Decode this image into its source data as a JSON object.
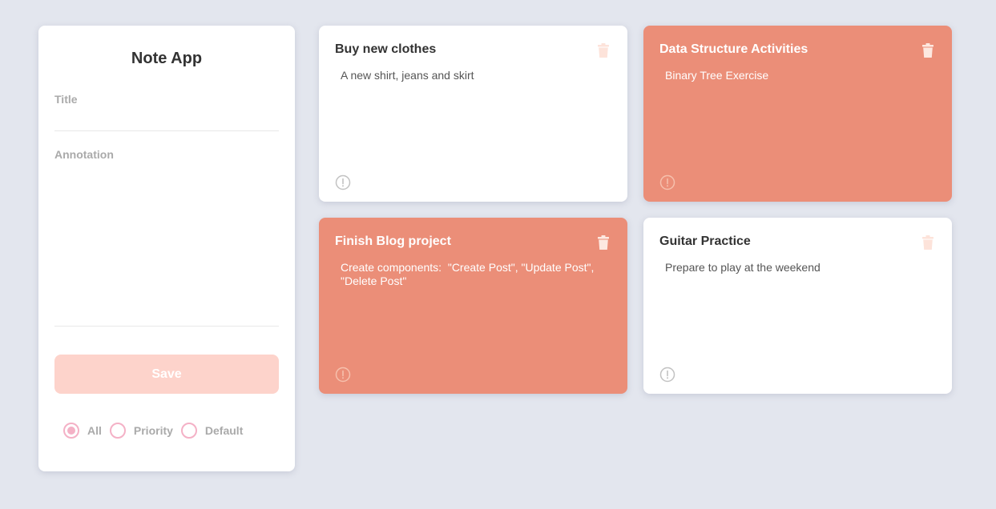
{
  "colors": {
    "background": "#e3e6ee",
    "card": "#ffffff",
    "note_salmon": "#eb8e78",
    "save_button": "#fdd3cb",
    "radio_accent": "#f4b1c6"
  },
  "form": {
    "title": "Note App",
    "title_label": "Title",
    "title_value": "",
    "annotation_label": "Annotation",
    "annotation_value": "",
    "save_label": "Save"
  },
  "filters": [
    {
      "label": "All",
      "checked": true
    },
    {
      "label": "Priority",
      "checked": false
    },
    {
      "label": "Default",
      "checked": false
    }
  ],
  "notes": [
    {
      "title": "Buy new clothes",
      "body": "A new shirt, jeans and skirt",
      "priority": false,
      "icons": [
        "trash-icon",
        "info-icon"
      ]
    },
    {
      "title": "Data Structure Activities",
      "body": "Binary Tree Exercise",
      "priority": true,
      "icons": [
        "trash-icon",
        "info-icon"
      ]
    },
    {
      "title": "Finish Blog project",
      "body": "Create components:  \"Create Post\", \"Update Post\",\n\"Delete Post\"",
      "priority": true,
      "icons": [
        "trash-icon",
        "info-icon"
      ]
    },
    {
      "title": "Guitar Practice",
      "body": "Prepare to play at the weekend",
      "priority": false,
      "icons": [
        "trash-icon",
        "info-icon"
      ]
    }
  ]
}
